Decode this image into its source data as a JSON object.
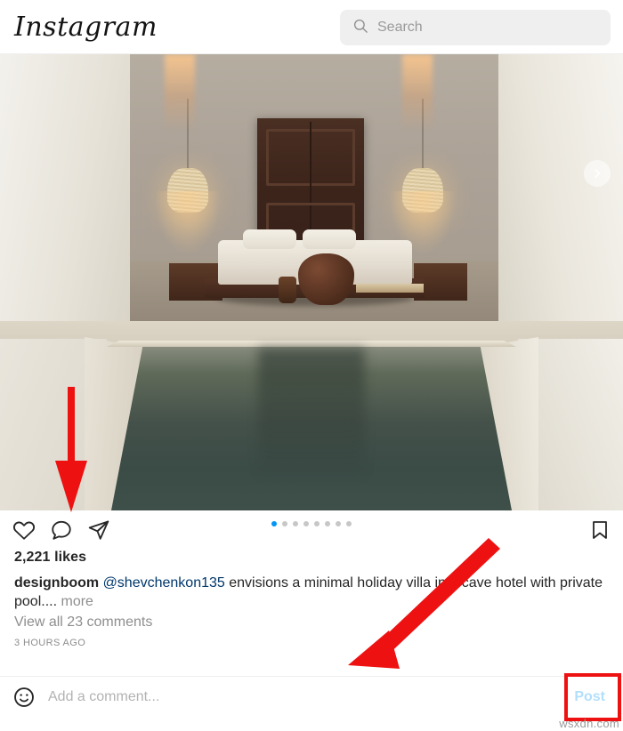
{
  "app": {
    "name": "Instagram",
    "watermark": "wsxdn.com"
  },
  "header": {
    "logo": "Instagram",
    "search": {
      "placeholder": "Search",
      "value": "",
      "icon": "search-icon"
    }
  },
  "post": {
    "media": {
      "alt": "Minimal holiday villa cave hotel bedroom with private pool",
      "carousel": {
        "total_dots": 8,
        "active_index": 0,
        "next_label": "Next"
      }
    },
    "actions": {
      "like": "like-icon",
      "comment": "comment-icon",
      "share": "share-icon",
      "save": "save-icon"
    },
    "likes": "2,221 likes",
    "caption": {
      "username": "designboom",
      "mention": "@shevchenkon135",
      "text": " envisions a minimal holiday villa in a cave hotel with private pool....",
      "more": "more"
    },
    "view_comments": "View all 23 comments",
    "timestamp": "3 HOURS AGO"
  },
  "comment_bar": {
    "emoji": "emoji-icon",
    "placeholder": "Add a comment...",
    "value": "",
    "post_label": "Post"
  },
  "colors": {
    "accent_blue": "#0095f6",
    "link_blue": "#00376b",
    "post_disabled": "#b2dffc",
    "annotation_red": "#ee1111",
    "muted_gray": "#8e8e8e"
  }
}
